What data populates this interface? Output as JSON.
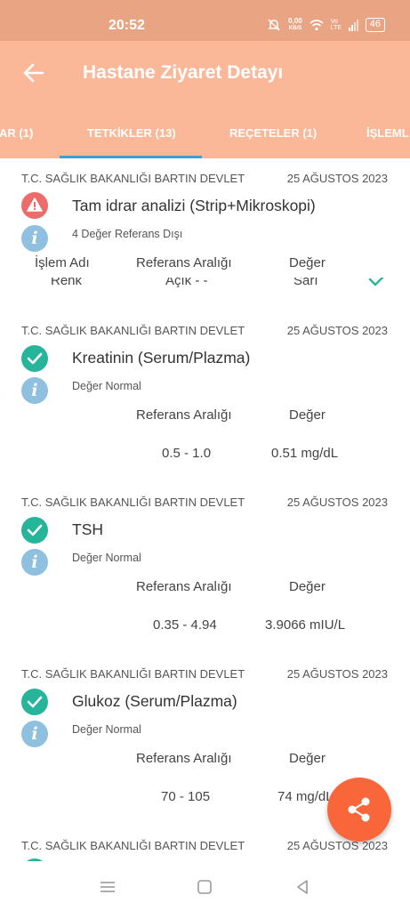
{
  "status_bar": {
    "time": "20:52",
    "net_speed_value": "0,00",
    "net_speed_unit": "KB/S",
    "volte": "Vo LTE",
    "battery": "46"
  },
  "header": {
    "title": "Hastane Ziyaret Detayı",
    "back_icon": "arrow-left-icon"
  },
  "tabs": [
    {
      "label": "AR (1)",
      "active": false
    },
    {
      "label": "TETKİKLER (13)",
      "active": true
    },
    {
      "label": "REÇETELER (1)",
      "active": false
    },
    {
      "label": "İŞLEML",
      "active": false
    }
  ],
  "tests": [
    {
      "hospital": "T.C. SAĞLIK BAKANLIĞI BARTIN DEVLET",
      "date": "25 AĞUSTOS 2023",
      "name": "Tam idrar analizi (Strip+Mikroskopi)",
      "status": "warning",
      "note": "4 Değer Referans Dışı",
      "col_name": "İşlem Adı",
      "col_range": "Referans Aralığı",
      "col_value": "Değer",
      "row_name": "Renk",
      "row_range": "Açık - -",
      "row_value": "Sarı"
    },
    {
      "hospital": "T.C. SAĞLIK BAKANLIĞI BARTIN DEVLET",
      "date": "25 AĞUSTOS 2023",
      "name": "Kreatinin (Serum/Plazma)",
      "status": "normal",
      "note": "Değer Normal",
      "col_range": "Referans Aralığı",
      "col_value": "Değer",
      "range": "0.5 - 1.0",
      "value": "0.51 mg/dL"
    },
    {
      "hospital": "T.C. SAĞLIK BAKANLIĞI BARTIN DEVLET",
      "date": "25 AĞUSTOS 2023",
      "name": "TSH",
      "status": "normal",
      "note": "Değer Normal",
      "col_range": "Referans Aralığı",
      "col_value": "Değer",
      "range": "0.35 - 4.94",
      "value": "3.9066 mIU/L"
    },
    {
      "hospital": "T.C. SAĞLIK BAKANLIĞI BARTIN DEVLET",
      "date": "25 AĞUSTOS 2023",
      "name": "Glukoz (Serum/Plazma)",
      "status": "normal",
      "note": "Değer Normal",
      "col_range": "Referans Aralığı",
      "col_value": "Değer",
      "range": "70 - 105",
      "value": "74 mg/dL"
    },
    {
      "hospital": "T.C. SAĞLIK BAKANLIĞI BARTIN DEVLET",
      "date": "25 AĞUSTOS 2023"
    }
  ],
  "fab": {
    "icon": "share-icon"
  },
  "nav": {
    "menu_icon": "menu-icon",
    "home_icon": "home-square-icon",
    "back_icon": "back-triangle-icon"
  },
  "colors": {
    "status_bar": "#e9a583",
    "app_bar": "#fbb899",
    "tab_indicator": "#3aa0d8",
    "ok": "#26b59a",
    "warning": "#ec6b6b",
    "info": "#8fc0e0",
    "fab": "#f8663a"
  }
}
